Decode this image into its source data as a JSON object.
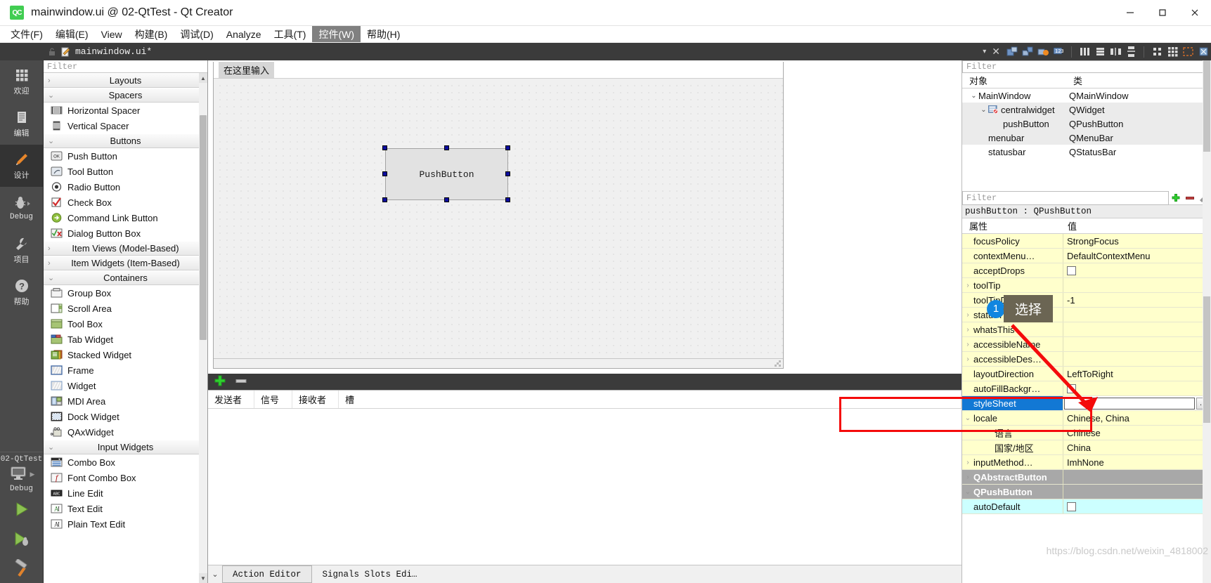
{
  "window": {
    "title": "mainwindow.ui @ 02-QtTest - Qt Creator",
    "logo_text": "QC",
    "minimize": "—",
    "maximize": "□",
    "close": "✕"
  },
  "menubar": [
    {
      "label": "文件(F)",
      "active": false
    },
    {
      "label": "编辑(E)",
      "active": false
    },
    {
      "label": "View",
      "active": false
    },
    {
      "label": "构建(B)",
      "active": false
    },
    {
      "label": "调试(D)",
      "active": false
    },
    {
      "label": "Analyze",
      "active": false
    },
    {
      "label": "工具(T)",
      "active": false
    },
    {
      "label": "控件(W)",
      "active": true
    },
    {
      "label": "帮助(H)",
      "active": false
    }
  ],
  "toolbar": {
    "filename": "mainwindow.ui*",
    "dropdown_caret": "▾",
    "close_label": "✕",
    "icons": [
      "edit-widgets-icon",
      "edit-signals-slots-icon",
      "edit-buddies-icon",
      "edit-tab-order-icon",
      "layout-horizontal-icon",
      "layout-vertical-icon",
      "layout-splitter-h-icon",
      "layout-splitter-v-icon",
      "layout-form-icon",
      "layout-grid-icon",
      "break-layout-icon",
      "adjust-size-icon"
    ]
  },
  "modebar": {
    "items": [
      {
        "label": "欢迎",
        "icon": "grid-welcome-icon",
        "selected": false
      },
      {
        "label": "编辑",
        "icon": "document-edit-icon",
        "selected": false
      },
      {
        "label": "设计",
        "icon": "pencil-design-icon",
        "selected": true
      },
      {
        "label": "Debug",
        "icon": "bug-debug-icon",
        "selected": false,
        "mono": true,
        "has_arrow": true
      },
      {
        "label": "项目",
        "icon": "wrench-projects-icon",
        "selected": false
      },
      {
        "label": "帮助",
        "icon": "question-help-icon",
        "selected": false
      }
    ],
    "kit": {
      "project": "02-QtTest",
      "build_config": "Debug",
      "target_icon": "monitor-target-icon",
      "run_icon": "run-play-icon",
      "debug_icon": "debug-play-icon",
      "build_icon": "hammer-build-icon"
    }
  },
  "widgetbox": {
    "filter_placeholder": "Filter",
    "groups": [
      {
        "name": "Layouts",
        "expanded": false,
        "items": []
      },
      {
        "name": "Spacers",
        "expanded": true,
        "items": [
          {
            "label": "Horizontal Spacer",
            "icon": "horizontal-spacer-icon"
          },
          {
            "label": "Vertical Spacer",
            "icon": "vertical-spacer-icon"
          }
        ]
      },
      {
        "name": "Buttons",
        "expanded": true,
        "items": [
          {
            "label": "Push Button",
            "icon": "push-button-icon"
          },
          {
            "label": "Tool Button",
            "icon": "tool-button-icon"
          },
          {
            "label": "Radio Button",
            "icon": "radio-button-icon"
          },
          {
            "label": "Check Box",
            "icon": "check-box-icon"
          },
          {
            "label": "Command Link Button",
            "icon": "command-link-button-icon"
          },
          {
            "label": "Dialog Button Box",
            "icon": "dialog-button-box-icon"
          }
        ]
      },
      {
        "name": "Item Views (Model-Based)",
        "expanded": false,
        "items": []
      },
      {
        "name": "Item Widgets (Item-Based)",
        "expanded": false,
        "items": []
      },
      {
        "name": "Containers",
        "expanded": true,
        "items": [
          {
            "label": "Group Box",
            "icon": "group-box-icon"
          },
          {
            "label": "Scroll Area",
            "icon": "scroll-area-icon"
          },
          {
            "label": "Tool Box",
            "icon": "tool-box-icon"
          },
          {
            "label": "Tab Widget",
            "icon": "tab-widget-icon"
          },
          {
            "label": "Stacked Widget",
            "icon": "stacked-widget-icon"
          },
          {
            "label": "Frame",
            "icon": "frame-icon"
          },
          {
            "label": "Widget",
            "icon": "widget-icon"
          },
          {
            "label": "MDI Area",
            "icon": "mdi-area-icon"
          },
          {
            "label": "Dock Widget",
            "icon": "dock-widget-icon"
          },
          {
            "label": "QAxWidget",
            "icon": "qax-widget-icon"
          }
        ]
      },
      {
        "name": "Input Widgets",
        "expanded": true,
        "items": [
          {
            "label": "Combo Box",
            "icon": "combo-box-icon"
          },
          {
            "label": "Font Combo Box",
            "icon": "font-combo-box-icon"
          },
          {
            "label": "Line Edit",
            "icon": "line-edit-icon"
          },
          {
            "label": "Text Edit",
            "icon": "text-edit-icon"
          },
          {
            "label": "Plain Text Edit",
            "icon": "plain-text-edit-icon"
          }
        ]
      }
    ]
  },
  "form": {
    "menu_placeholder": "在这里输入",
    "button_text": "PushButton"
  },
  "signal_slot_editor": {
    "add_label": "+",
    "remove_label": "—",
    "columns": [
      "发送者",
      "信号",
      "接收者",
      "槽"
    ],
    "rows": []
  },
  "bottom_tabs": {
    "chevron": "⌄",
    "tabs": [
      {
        "label": "Action Editor",
        "selected": true
      },
      {
        "label": "Signals  Slots Edi…",
        "selected": false
      }
    ]
  },
  "object_inspector": {
    "filter_placeholder": "Filter",
    "columns": [
      "对象",
      "类"
    ],
    "rows": [
      {
        "name": "MainWindow",
        "cls": "QMainWindow",
        "indent": 0,
        "chevron": "⌄",
        "icon": null,
        "selected": false
      },
      {
        "name": "centralwidget",
        "cls": "QWidget",
        "indent": 1,
        "chevron": "⌄",
        "icon": "no-layout-icon",
        "selected": true
      },
      {
        "name": "pushButton",
        "cls": "QPushButton",
        "indent": 2,
        "chevron": "",
        "icon": null,
        "selected": true
      },
      {
        "name": "menubar",
        "cls": "QMenuBar",
        "indent": 1,
        "chevron": "",
        "icon": null,
        "selected": true
      },
      {
        "name": "statusbar",
        "cls": "QStatusBar",
        "indent": 1,
        "chevron": "",
        "icon": null,
        "selected": false
      }
    ]
  },
  "property_editor": {
    "filter_placeholder": "Filter",
    "add_button": "+",
    "remove_button": "—",
    "config_button": "⚒",
    "object_line": "pushButton : QPushButton",
    "columns": [
      "属性",
      "值"
    ],
    "rows": [
      {
        "key": "focusPolicy",
        "value": "StrongFocus",
        "chevron": "",
        "type": "text"
      },
      {
        "key": "contextMenu…",
        "value": "DefaultContextMenu",
        "chevron": "",
        "type": "text"
      },
      {
        "key": "acceptDrops",
        "value": "",
        "chevron": "",
        "type": "checkbox",
        "checked": false
      },
      {
        "key": "toolTip",
        "value": "",
        "chevron": "›",
        "type": "text"
      },
      {
        "key": "toolTipDuration",
        "value": "-1",
        "chevron": "",
        "type": "text"
      },
      {
        "key": "statusTip",
        "value": "",
        "chevron": "›",
        "type": "text"
      },
      {
        "key": "whatsThis",
        "value": "",
        "chevron": "›",
        "type": "text"
      },
      {
        "key": "accessibleName",
        "value": "",
        "chevron": "›",
        "type": "text"
      },
      {
        "key": "accessibleDes…",
        "value": "",
        "chevron": "›",
        "type": "text"
      },
      {
        "key": "layoutDirection",
        "value": "LeftToRight",
        "chevron": "",
        "type": "text"
      },
      {
        "key": "autoFillBackgr…",
        "value": "",
        "chevron": "",
        "type": "checkbox",
        "checked": false
      },
      {
        "key": "styleSheet",
        "value": "",
        "chevron": "",
        "type": "edit",
        "selected": true
      },
      {
        "key": "locale",
        "value": "Chinese, China",
        "chevron": "⌄",
        "type": "text"
      },
      {
        "key": "语言",
        "value": "Chinese",
        "chevron": "",
        "type": "text",
        "sub": true
      },
      {
        "key": "国家/地区",
        "value": "China",
        "chevron": "",
        "type": "text",
        "sub": true
      },
      {
        "key": "inputMethod…",
        "value": "ImhNone",
        "chevron": "›",
        "type": "text"
      },
      {
        "key": "QAbstractButton",
        "value": "",
        "chevron": "›",
        "type": "group"
      },
      {
        "key": "QPushButton",
        "value": "",
        "chevron": "⌄",
        "type": "group"
      },
      {
        "key": "autoDefault",
        "value": "",
        "chevron": "",
        "type": "checkbox",
        "checked": false,
        "cyan": true
      }
    ]
  },
  "annotation": {
    "badge": "1",
    "label": "选择",
    "highlight_color": "#f40b0b",
    "badge_color": "#1186e0",
    "bubble_color": "#6b6553"
  },
  "watermark": "https://blog.csdn.net/weixin_4818002"
}
